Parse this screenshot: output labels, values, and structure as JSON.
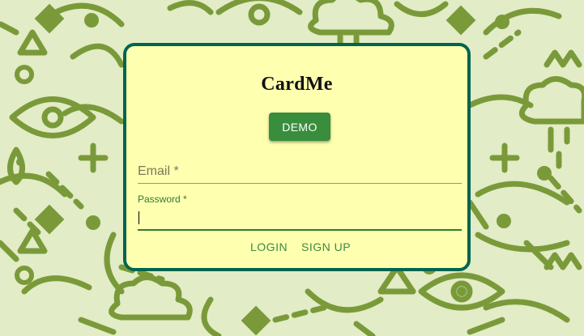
{
  "app": {
    "title": "CardMe"
  },
  "buttons": {
    "demo_label": "DEMO",
    "login_label": "LOGIN",
    "signup_label": "SIGN UP"
  },
  "form": {
    "email": {
      "label": "Email *",
      "value": ""
    },
    "password": {
      "label": "Password *",
      "value": ""
    }
  },
  "colors": {
    "background": "#e2ecc6",
    "pattern": "#7a9a3a",
    "card_background": "#ffffb0",
    "card_border": "#006450",
    "primary_button": "#388e3c",
    "accent_text": "#3d8a41"
  },
  "decorations": {
    "background_pattern_icons": [
      "diamond-icon",
      "circle-icon",
      "triangle-icon",
      "plus-icon",
      "eye-icon",
      "cloud-rain-icon",
      "drop-icon",
      "wave-icon",
      "zigzag-icon"
    ]
  }
}
